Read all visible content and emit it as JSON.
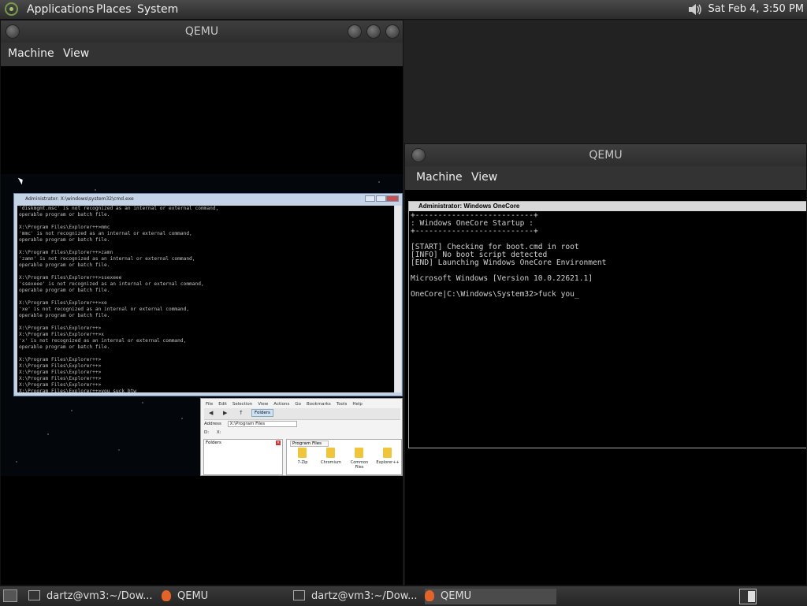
{
  "top_panel": {
    "menus": [
      "Applications",
      "Places",
      "System"
    ],
    "clock": "Sat Feb  4,  3:50 PM"
  },
  "qemu_left": {
    "title": "QEMU",
    "menu": [
      "Machine",
      "View"
    ],
    "cmd_window": {
      "title": "Administrator: X:\\windows\\system32\\cmd.exe",
      "lines": [
        "'diskmgmt.msc' is not recognized as an internal or external command,",
        "operable program or batch file.",
        "",
        "X:\\Program Files\\Explorer++>mmc",
        "'mmc' is not recognized as an internal or external command,",
        "operable program or batch file.",
        "",
        "X:\\Program Files\\Explorer++>zamn",
        "'zamn' is not recognized as an internal or external command,",
        "operable program or batch file.",
        "",
        "X:\\Program Files\\Explorer++>ssexeee",
        "'ssexeee' is not recognized as an internal or external command,",
        "operable program or batch file.",
        "",
        "X:\\Program Files\\Explorer++>xe",
        "'xe' is not recognized as an internal or external command,",
        "operable program or batch file.",
        "",
        "X:\\Program Files\\Explorer++>",
        "X:\\Program Files\\Explorer++>x",
        "'x' is not recognized as an internal or external command,",
        "operable program or batch file.",
        "",
        "X:\\Program Files\\Explorer++>",
        "X:\\Program Files\\Explorer++>",
        "X:\\Program Files\\Explorer++>",
        "X:\\Program Files\\Explorer++>",
        "X:\\Program Files\\Explorer++>",
        "X:\\Program Files\\Explorer++>you suck btw"
      ]
    },
    "explorer": {
      "menu": [
        "File",
        "Edit",
        "Selection",
        "View",
        "Actions",
        "Go",
        "Bookmarks",
        "Tools",
        "Help"
      ],
      "folders_button": "Folders",
      "address_label": "Address",
      "address_value": "X:\\Program Files",
      "drives": [
        "D:",
        "X:"
      ],
      "folders_pane_title": "Folders",
      "tab_label": "Program Files",
      "files": [
        "7-Zip",
        "Chromium",
        "Common Files",
        "Explorer++"
      ]
    }
  },
  "qemu_right": {
    "title": "QEMU",
    "menu": [
      "Machine",
      "View"
    ],
    "console": {
      "title": "Administrator: Windows OneCore",
      "lines": [
        "+--------------------------+",
        ": Windows OneCore Startup :",
        "+--------------------------+",
        "",
        "[START] Checking for boot.cmd in root",
        "[INFO] No boot script detected",
        "[END] Launching Windows OneCore Environment",
        "",
        "Microsoft Windows [Version 10.0.22621.1]",
        "",
        "OneCore|C:\\Windows\\System32>fuck you_"
      ]
    }
  },
  "taskbar": {
    "items": [
      {
        "label": "dartz@vm3:~/Dow...",
        "icon": "terminal-icon"
      },
      {
        "label": "QEMU",
        "icon": "qemu-icon"
      },
      {
        "label": "dartz@vm3:~/Dow...",
        "icon": "terminal-icon"
      },
      {
        "label": "QEMU",
        "icon": "qemu-icon",
        "active": true
      }
    ]
  }
}
